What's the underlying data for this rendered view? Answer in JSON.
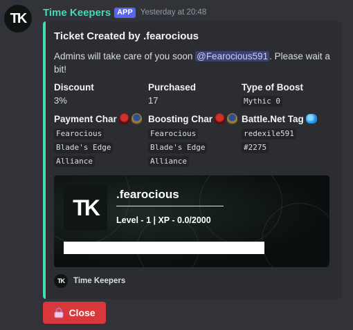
{
  "message": {
    "avatar_text": "TK",
    "username": "Time Keepers",
    "badge": "APP",
    "timestamp": "Yesterday at 20:48"
  },
  "embed": {
    "accent_color": "#45d9b5",
    "title": "Ticket Created by .fearocious",
    "description_before": "Admins will take care of you soon ",
    "mention": "@Fearocious591",
    "description_after": ". Please wait a bit!",
    "fields": {
      "discount": {
        "name": "Discount",
        "value": "3%"
      },
      "purchased": {
        "name": "Purchased",
        "value": "17"
      },
      "boost_type": {
        "name": "Type of Boost",
        "value": "Mythic 0"
      },
      "payment_char": {
        "name": "Payment Char",
        "lines": [
          "Fearocious",
          "Blade's Edge",
          "Alliance"
        ],
        "icons": [
          "horde-icon",
          "alliance-icon"
        ]
      },
      "boosting_char": {
        "name": "Boosting Char",
        "lines": [
          "Fearocious",
          "Blade's Edge",
          "Alliance"
        ],
        "icons": [
          "horde-icon",
          "alliance-icon"
        ]
      },
      "battlenet": {
        "name": "Battle.Net Tag",
        "lines": [
          "redexile591",
          "#2275"
        ],
        "icon": "battlenet-icon"
      }
    },
    "banner": {
      "avatar_text": "TK",
      "name": ".fearocious",
      "level_text": "Level - 1 | XP - 0.0/2000",
      "xp_progress": 0.0
    },
    "footer": {
      "icon_text": "TK",
      "text": "Time Keepers"
    }
  },
  "actions": {
    "close_label": "Close",
    "close_icon": "lock-icon",
    "close_color": "#da373c"
  }
}
